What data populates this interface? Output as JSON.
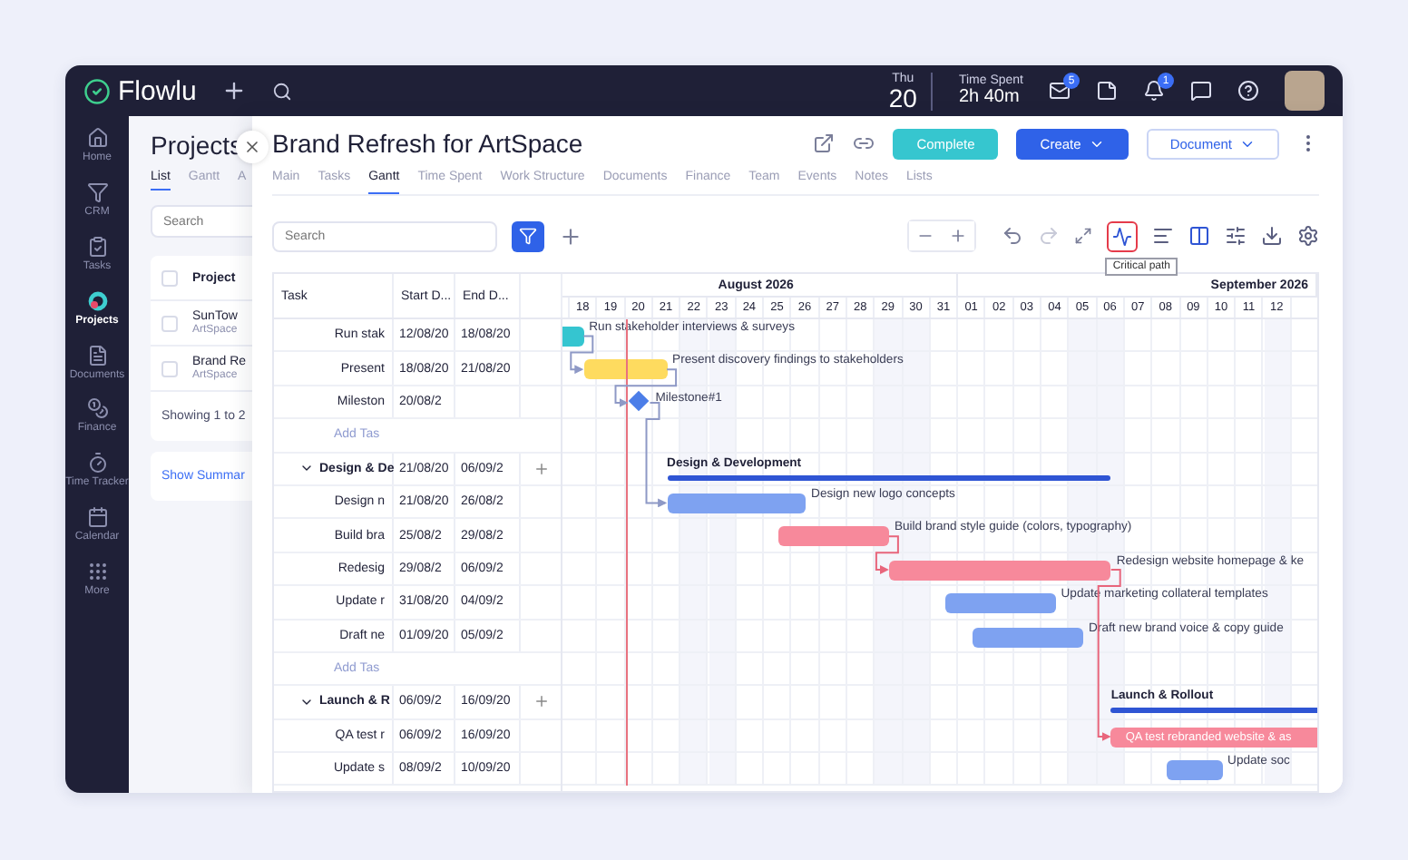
{
  "topbar": {
    "logo": "Flowlu",
    "weekday": "Thu",
    "day": "20",
    "time_label": "Time Spent",
    "time_value": "2h 40m",
    "mail_badge": "5",
    "bell_badge": "1"
  },
  "sidebar": {
    "items": [
      {
        "label": "Home",
        "selected": false
      },
      {
        "label": "CRM",
        "selected": false
      },
      {
        "label": "Tasks",
        "selected": false
      },
      {
        "label": "Projects",
        "selected": true
      },
      {
        "label": "Documents",
        "selected": false
      },
      {
        "label": "Finance",
        "selected": false
      },
      {
        "label": "Time Tracker",
        "selected": false
      },
      {
        "label": "Calendar",
        "selected": false
      },
      {
        "label": "More",
        "selected": false
      }
    ]
  },
  "projects_panel": {
    "title": "Projects",
    "tabs": [
      {
        "label": "List",
        "selected": true
      },
      {
        "label": "Gantt",
        "selected": false
      },
      {
        "label": "A",
        "selected": false
      }
    ],
    "search": {
      "placeholder": "Search"
    },
    "column": "Project",
    "all_checked": false,
    "rows": [
      {
        "name": "SunTow",
        "client": "ArtSpace",
        "checked": false
      },
      {
        "name": "Brand Re",
        "client": "ArtSpace",
        "checked": false
      }
    ],
    "footer": "Showing 1 to 2",
    "summary_link": "Show Summar"
  },
  "project": {
    "title": "Brand Refresh for ArtSpace",
    "complete": "Complete",
    "create": "Create",
    "document": "Document",
    "tabs": [
      {
        "label": "Main",
        "selected": false
      },
      {
        "label": "Tasks",
        "selected": false
      },
      {
        "label": "Gantt",
        "selected": true
      },
      {
        "label": "Time Spent",
        "selected": false
      },
      {
        "label": "Work Structure",
        "selected": false
      },
      {
        "label": "Documents",
        "selected": false
      },
      {
        "label": "Finance",
        "selected": false
      },
      {
        "label": "Team",
        "selected": false
      },
      {
        "label": "Events",
        "selected": false
      },
      {
        "label": "Notes",
        "selected": false
      },
      {
        "label": "Lists",
        "selected": false
      }
    ]
  },
  "gantt": {
    "search": {
      "placeholder": "Search"
    },
    "critical_path_on": true,
    "tooltip": "Critical path",
    "columns": [
      "Task",
      "Start D...",
      "End D..."
    ],
    "months": [
      "August 2026",
      "September 2026"
    ],
    "days": [
      "18",
      "19",
      "20",
      "21",
      "22",
      "23",
      "24",
      "25",
      "26",
      "27",
      "28",
      "29",
      "30",
      "31",
      "01",
      "02",
      "03",
      "04",
      "05",
      "06",
      "07",
      "08",
      "09",
      "10",
      "11",
      "12"
    ],
    "rows": [
      {
        "kind": "task",
        "name": "Run stak",
        "start": "12/08/20",
        "end": "18/08/20",
        "bar_label": "Run stakeholder interviews & surveys",
        "color": "#35c5d0"
      },
      {
        "kind": "task",
        "name": "Present",
        "start": "18/08/20",
        "end": "21/08/20",
        "bar_label": "Present discovery findings to stakeholders",
        "color": "#fedb5f"
      },
      {
        "kind": "milestone",
        "name": "Mileston",
        "start": "20/08/2",
        "bar_label": "Milestone#1"
      },
      {
        "kind": "add",
        "name": "Add Tas"
      },
      {
        "kind": "group",
        "name": "Design & De",
        "start": "21/08/20",
        "end": "06/09/2",
        "bar_label": "Design & Development",
        "expanded": true
      },
      {
        "kind": "task",
        "name": "Design n",
        "start": "21/08/20",
        "end": "26/08/2",
        "bar_label": "Design new logo concepts",
        "color": "#7ea2f1"
      },
      {
        "kind": "task",
        "name": "Build bra",
        "start": "25/08/2",
        "end": "29/08/2",
        "bar_label": "Build brand style guide (colors, typography)",
        "color": "#f7899b",
        "critical": true
      },
      {
        "kind": "task",
        "name": "Redesig",
        "start": "29/08/2",
        "end": "06/09/2",
        "bar_label": "Redesign website homepage & ke",
        "color": "#f7899b",
        "critical": true
      },
      {
        "kind": "task",
        "name": "Update r",
        "start": "31/08/20",
        "end": "04/09/2",
        "bar_label": "Update marketing collateral templates",
        "color": "#7ea2f1"
      },
      {
        "kind": "task",
        "name": "Draft ne",
        "start": "01/09/20",
        "end": "05/09/2",
        "bar_label": "Draft new brand voice & copy guide",
        "color": "#7ea2f1"
      },
      {
        "kind": "add",
        "name": "Add Tas"
      },
      {
        "kind": "group",
        "name": "Launch & R",
        "start": "06/09/2",
        "end": "16/09/20",
        "bar_label": "Launch & Rollout",
        "expanded": true
      },
      {
        "kind": "task",
        "name": "QA test r",
        "start": "06/09/2",
        "end": "16/09/20",
        "bar_label": "QA test rebranded website & as",
        "color": "#f7899b",
        "critical": true,
        "label_inside": true
      },
      {
        "kind": "task",
        "name": "Update s",
        "start": "08/09/2",
        "end": "10/09/20",
        "bar_label": "Update soc",
        "color": "#7ea2f1"
      }
    ],
    "links_shown": true
  }
}
